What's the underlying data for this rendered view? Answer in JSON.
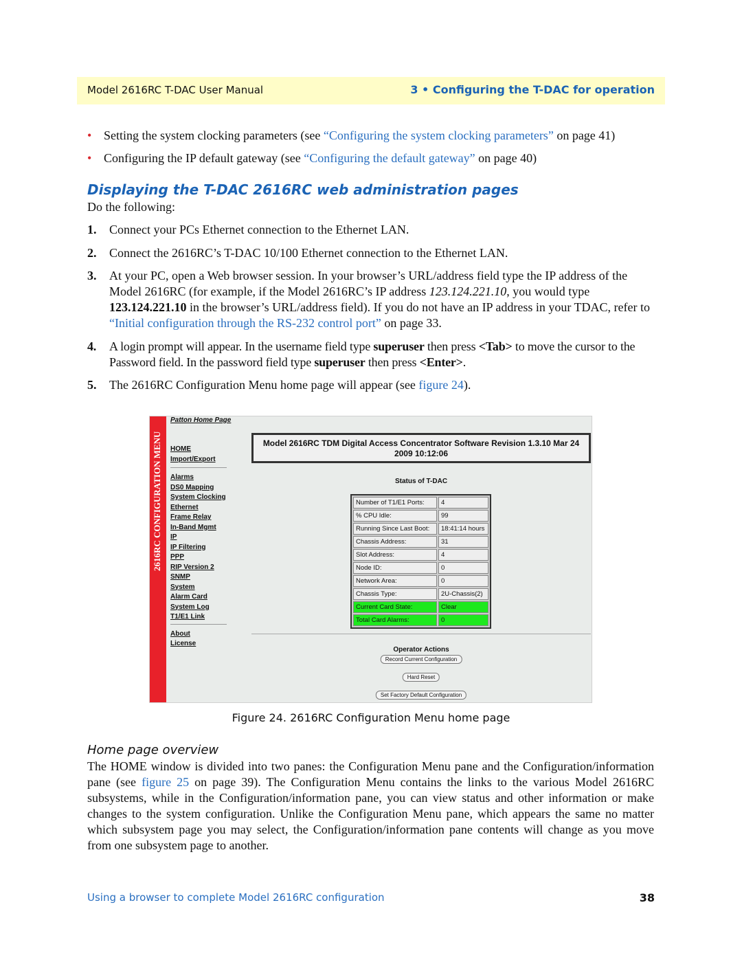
{
  "header": {
    "left": "Model 2616RC T-DAC User Manual",
    "right": "3 • Configuring the T-DAC for operation"
  },
  "bullets": [
    {
      "pre": "Setting the system clocking parameters (see ",
      "link": "“Configuring the system clocking parameters”",
      "post": " on page 41)"
    },
    {
      "pre": "Configuring the IP default gateway (see ",
      "link": "“Configuring the default gateway”",
      "post": " on page 40)"
    }
  ],
  "section_title": "Displaying the T-DAC 2616RC web administration pages",
  "intro": "Do the following:",
  "steps": [
    {
      "n": "1.",
      "text": "Connect your PCs Ethernet connection to the Ethernet LAN."
    },
    {
      "n": "2.",
      "text": "Connect the 2616RC’s T-DAC 10/100 Ethernet connection to the Ethernet LAN."
    },
    {
      "n": "3.",
      "a": "At your PC, open a Web browser session. In your browser’s URL/address field type the IP address of the Model 2616RC (for example, if the Model 2616RC’s IP address ",
      "b": "123.124.221.10",
      "c": ", you would type ",
      "d": "123.124.221.10",
      "e": " in the browser’s URL/address field). If you do not have an IP address in your TDAC, refer to ",
      "link": "“Initial configuration through the RS-232 control port”",
      "f": " on page 33."
    },
    {
      "n": "4.",
      "a": "A login prompt will appear. In the username field type ",
      "b": "superuser",
      "c": " then press ",
      "d": "<Tab>",
      "e": " to move the cursor to the Password field. In the password field type ",
      "f": "superuser",
      "g": " then press ",
      "h": "<Enter>",
      "i": "."
    },
    {
      "n": "5.",
      "a": "The 2616RC Configuration Menu home page will appear (see ",
      "link": "figure 24",
      "b": ")."
    }
  ],
  "figure": {
    "side_title": "2616RC CONFIGURATION MENU",
    "home_link": "Patton Home Page",
    "menu_group1": [
      "HOME",
      "Import/Export"
    ],
    "menu_group2": [
      "Alarms",
      "DS0 Mapping",
      "System Clocking",
      "Ethernet",
      "Frame Relay",
      "In-Band Mgmt",
      "IP",
      "IP Filtering",
      "PPP",
      "RIP Version 2",
      "SNMP",
      "System",
      "Alarm Card",
      "System Log",
      "T1/E1 Link"
    ],
    "menu_group3": [
      "About",
      "License"
    ],
    "banner": "Model 2616RC TDM Digital Access Concentrator Software Revision 1.3.10 Mar 24 2009 10:12:06",
    "status_title": "Status of T-DAC",
    "status_rows": [
      {
        "k": "Number of T1/E1 Ports:",
        "v": "4"
      },
      {
        "k": "% CPU Idle:",
        "v": "99"
      },
      {
        "k": "Running Since Last Boot:",
        "v": "18:41:14 hours"
      },
      {
        "k": "Chassis Address:",
        "v": "31"
      },
      {
        "k": "Slot Address:",
        "v": "4"
      },
      {
        "k": "Node ID:",
        "v": "0"
      },
      {
        "k": "Network Area:",
        "v": "0"
      },
      {
        "k": "Chassis Type:",
        "v": "2U-Chassis(2)"
      },
      {
        "k": "Current Card State:",
        "v": "Clear"
      },
      {
        "k": "Total Card Alarms:",
        "v": "0"
      }
    ],
    "highlight_color": "#1ee81e",
    "ops_title": "Operator Actions",
    "buttons": [
      "Record Current Configuration",
      "Hard Reset",
      "Set Factory Default Configuration"
    ]
  },
  "caption": "Figure 24. 2616RC Configuration Menu home page",
  "subheading": "Home page overview",
  "overview": {
    "a": "The HOME window is divided into two panes: the Configuration Menu pane and the Configuration/information pane (see ",
    "link": "figure 25",
    "b": " on page 39). The Configuration Menu contains the links to the various Model 2616RC subsystems, while in the Configuration/information pane, you can view status and other information or make changes to the system configuration. Unlike the Configuration Menu pane, which appears the same no matter which subsystem page you may select, the Configuration/information pane contents will change as you move from one subsystem page to another."
  },
  "footer": {
    "left": "Using a browser to complete Model 2616RC configuration",
    "page": "38"
  }
}
